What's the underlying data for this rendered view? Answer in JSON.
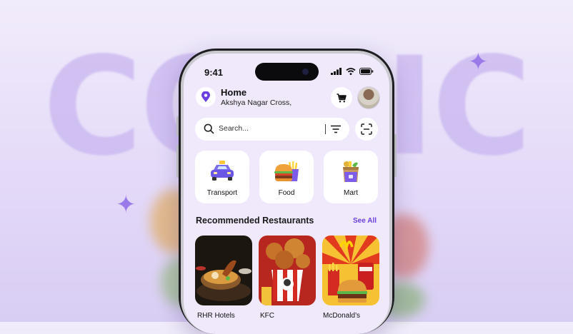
{
  "background": {
    "word": "COMIC"
  },
  "status_bar": {
    "time": "9:41"
  },
  "location": {
    "title": "Home",
    "subtitle": "Akshya Nagar Cross,"
  },
  "icons": {
    "location": "location-pin-icon",
    "cart": "cart-icon",
    "search": "search-icon",
    "filter": "filter-icon",
    "scan": "scan-icon"
  },
  "search": {
    "placeholder": "Search..."
  },
  "categories": [
    {
      "label": "Transport",
      "icon": "taxi-icon"
    },
    {
      "label": "Food",
      "icon": "burger-fries-icon"
    },
    {
      "label": "Mart",
      "icon": "grocery-bag-icon"
    }
  ],
  "recommended": {
    "title": "Recommended Restaurants",
    "see_all": "See All",
    "restaurants": [
      {
        "name": "RHR Hotels"
      },
      {
        "name": "KFC"
      },
      {
        "name": "McDonald’s"
      }
    ]
  },
  "colors": {
    "accent": "#6c3fe0",
    "screen_bg": "#efe9fb",
    "page_bg": "#e6dcf8"
  }
}
